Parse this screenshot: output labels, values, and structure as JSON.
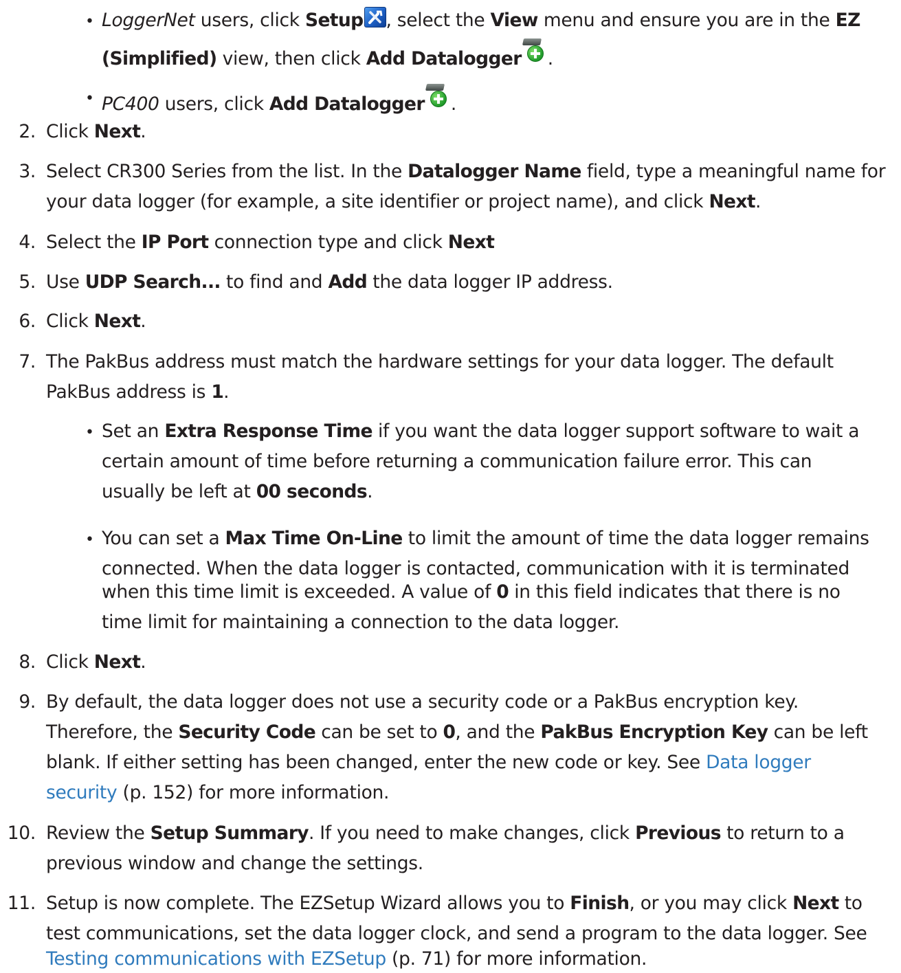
{
  "lines": {
    "b1_l1": [
      "LoggerNet",
      " users, click ",
      "Setup",
      ", select the ",
      "View",
      " menu and ensure you are in the ",
      "EZ"
    ],
    "b1_l2": [
      "(Simplified)",
      " view, then click ",
      "Add Datalogger",
      "."
    ],
    "b2": [
      "PC400",
      " users, click ",
      "Add Datalogger",
      "."
    ],
    "s2": [
      "Click ",
      "Next",
      "."
    ],
    "s3_l1": [
      "Select CR300 Series from the list. In the ",
      "Datalogger Name",
      " field, type a meaningful name for"
    ],
    "s3_l2": [
      "your data logger (for example, a site identifier or project name), and click ",
      "Next",
      "."
    ],
    "s4": [
      "Select the ",
      "IP Port",
      " connection type and click ",
      "Next"
    ],
    "s5": [
      "Use ",
      "UDP Search...",
      " to find and ",
      "Add",
      " the data logger IP address."
    ],
    "s6": [
      "Click ",
      "Next",
      "."
    ],
    "s7_l1": "The PakBus address must match the hardware settings for your data logger. The default",
    "s7_l2": [
      "PakBus address is ",
      "1",
      "."
    ],
    "b7a_l1": [
      "Set an ",
      "Extra Response Time",
      " if you want the data logger support software to wait a"
    ],
    "b7a_l2": "certain amount of time before returning a communication failure error. This can",
    "b7a_l3": [
      "usually be left at ",
      "00 seconds",
      "."
    ],
    "b7b_l1": [
      "You can set a ",
      "Max Time On-Line",
      " to limit the amount of time the data logger remains"
    ],
    "b7b_l2": "connected. When the data logger is contacted, communication with it is terminated",
    "b7b_l3": [
      "when this time limit is exceeded. A value of ",
      "0",
      " in this field indicates that there is no"
    ],
    "b7b_l4": "time limit for maintaining a connection to the data logger.",
    "s8": [
      "Click ",
      "Next",
      "."
    ],
    "s9_l1": "By default, the data logger does not use a security code or a PakBus encryption key.",
    "s9_l2": [
      "Therefore, the ",
      "Security Code",
      " can be set to ",
      "0",
      ", and the ",
      "PakBus Encryption Key",
      " can be left"
    ],
    "s9_l3": [
      "blank. If either setting has been changed, enter the new code or key. See ",
      "Data logger"
    ],
    "s9_l4": [
      "security",
      " (p. 152) for more information."
    ],
    "s10_l1": [
      "Review the ",
      "Setup Summary",
      ". If you need to make changes, click ",
      "Previous",
      " to return to a"
    ],
    "s10_l2": "previous window and change the settings.",
    "s11_l1": [
      "Setup is now complete. The EZSetup Wizard allows you to ",
      "Finish",
      ", or you may click ",
      "Next",
      " to"
    ],
    "s11_l2": "test communications, set the data logger clock, and send a program to the data logger. See",
    "s11_l3": [
      "Testing communications with EZSetup",
      " (p. 71) for more information."
    ]
  },
  "numbers": [
    "2.",
    "3.",
    "4.",
    "5.",
    "6.",
    "7.",
    "8.",
    "9.",
    "10.",
    "11."
  ],
  "bullet_char": "•",
  "icons": {
    "setup": "setup-tools-icon",
    "add_datalogger": "add-datalogger-icon"
  },
  "colors": {
    "text": "#231f20",
    "link": "#2f7bbd",
    "background": "#ffffff"
  }
}
